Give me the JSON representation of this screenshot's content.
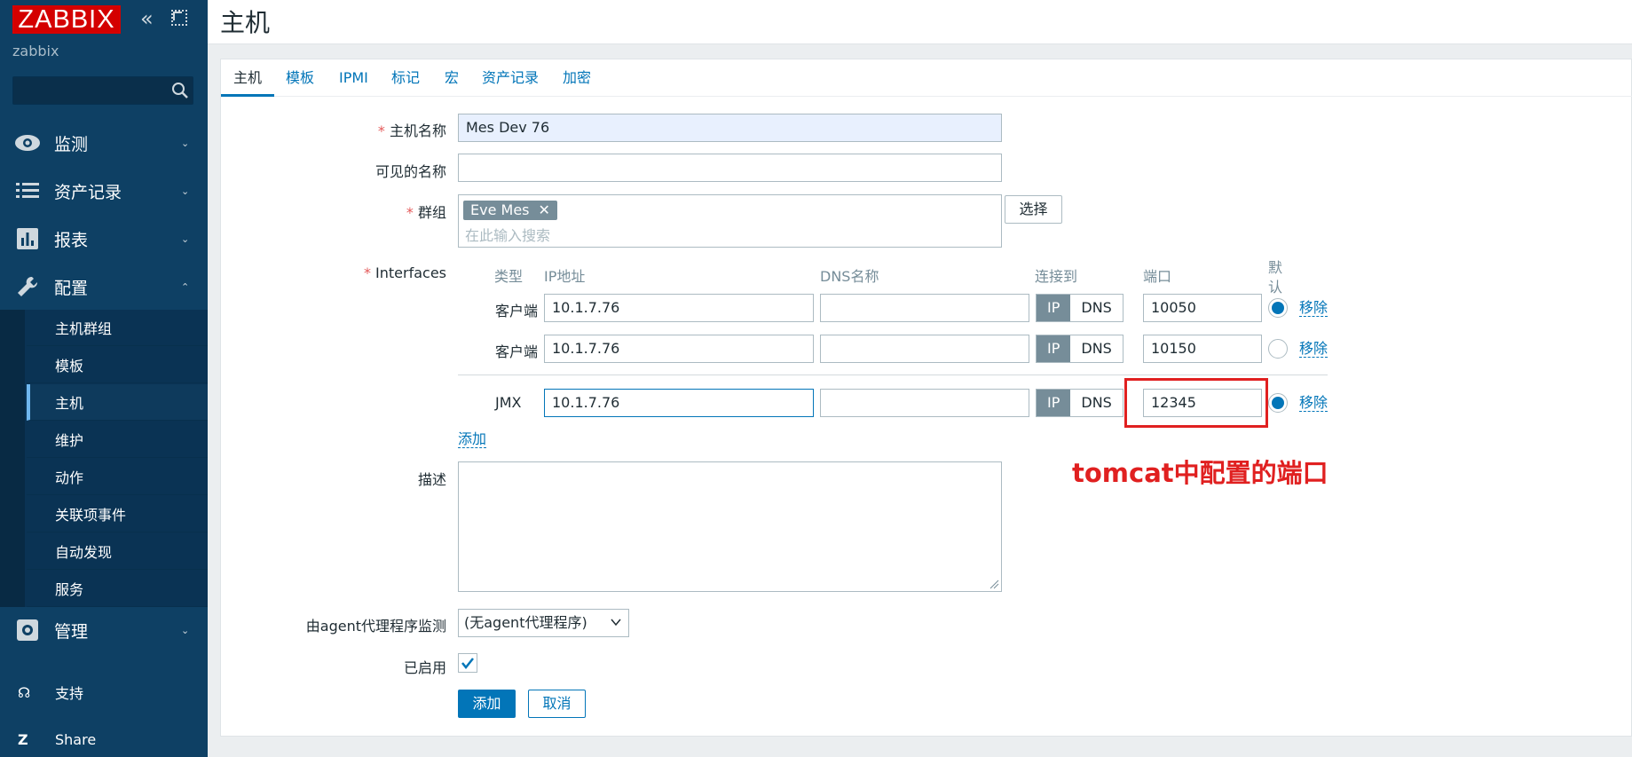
{
  "sidebar": {
    "logo": "ZABBIX",
    "server_name": "zabbix",
    "search_placeholder": "",
    "menu": [
      {
        "label": "监测"
      },
      {
        "label": "资产记录"
      },
      {
        "label": "报表"
      },
      {
        "label": "配置"
      },
      {
        "label": "管理"
      }
    ],
    "submenu": [
      {
        "label": "主机群组"
      },
      {
        "label": "模板"
      },
      {
        "label": "主机"
      },
      {
        "label": "维护"
      },
      {
        "label": "动作"
      },
      {
        "label": "关联项事件"
      },
      {
        "label": "自动发现"
      },
      {
        "label": "服务"
      }
    ],
    "footer": [
      {
        "label": "支持"
      },
      {
        "label": "Share"
      }
    ]
  },
  "header": {
    "title": "主机"
  },
  "tabs": [
    {
      "label": "主机"
    },
    {
      "label": "模板"
    },
    {
      "label": "IPMI"
    },
    {
      "label": "标记"
    },
    {
      "label": "宏"
    },
    {
      "label": "资产记录"
    },
    {
      "label": "加密"
    }
  ],
  "form": {
    "host_name_label": "主机名称",
    "host_name_value": "Mes Dev 76",
    "visible_name_label": "可见的名称",
    "visible_name_value": "",
    "groups_label": "群组",
    "group_tag": "Eve Mes",
    "group_remove": "✕",
    "groups_placeholder": "在此输入搜索",
    "select_button": "选择",
    "interfaces_label": "Interfaces",
    "required_mark": "*",
    "columns": {
      "type": "类型",
      "ip": "IP地址",
      "dns": "DNS名称",
      "connect": "连接到",
      "port": "端口",
      "default_1": "默",
      "default_2": "认"
    },
    "interfaces": [
      {
        "type": "客户端",
        "ip": "10.1.7.76",
        "dns": "",
        "ip_label": "IP",
        "dns_label": "DNS",
        "port": "10050",
        "default": true,
        "remove": "移除"
      },
      {
        "type": "客户端",
        "ip": "10.1.7.76",
        "dns": "",
        "ip_label": "IP",
        "dns_label": "DNS",
        "port": "10150",
        "default": false,
        "remove": "移除"
      },
      {
        "type": "JMX",
        "ip": "10.1.7.76",
        "dns": "",
        "ip_label": "IP",
        "dns_label": "DNS",
        "port": "12345",
        "default": true,
        "remove": "移除"
      }
    ],
    "add_interface": "添加",
    "description_label": "描述",
    "description_value": "",
    "proxy_label": "由agent代理程序监测",
    "proxy_value": "(无agent代理程序)",
    "enabled_label": "已启用",
    "enabled": true,
    "add_button": "添加",
    "cancel_button": "取消"
  },
  "annotation": {
    "text": "tomcat中配置的端口",
    "color": "#e02020"
  },
  "colors": {
    "sidebar": "#0e4064",
    "accent": "#0275b8",
    "logo": "#d40000"
  }
}
